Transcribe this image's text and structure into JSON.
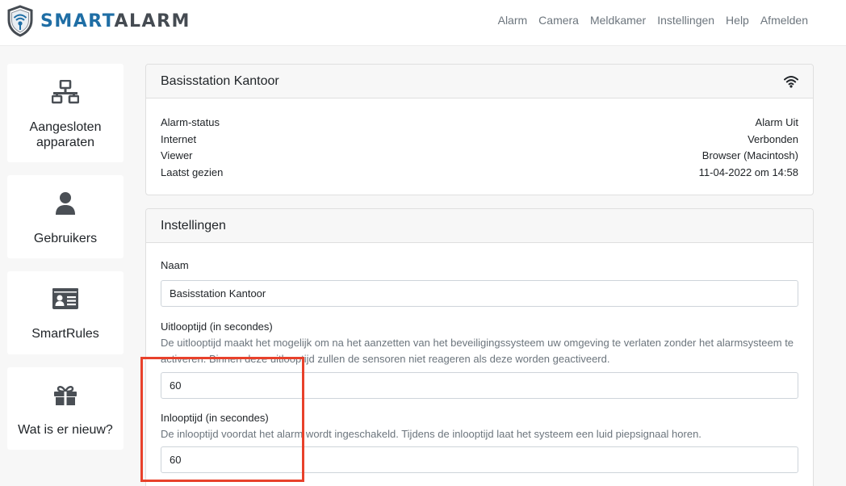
{
  "brand": {
    "part1": "SMART",
    "part2": "ALARM"
  },
  "nav": [
    "Alarm",
    "Camera",
    "Meldkamer",
    "Instellingen",
    "Help",
    "Afmelden"
  ],
  "sidebar": {
    "tiles": [
      {
        "label_line1": "Aangesloten",
        "label_line2": "apparaten",
        "icon": "network-icon"
      },
      {
        "label": "Gebruikers",
        "icon": "user-icon"
      },
      {
        "label": "SmartRules",
        "icon": "id-card-icon"
      },
      {
        "label": "Wat is er nieuw?",
        "icon": "gift-icon"
      }
    ]
  },
  "station": {
    "title": "Basisstation Kantoor",
    "rows": [
      {
        "label": "Alarm-status",
        "value": "Alarm Uit"
      },
      {
        "label": "Internet",
        "value": "Verbonden"
      },
      {
        "label": "Viewer",
        "value": "Browser (Macintosh)"
      },
      {
        "label": "Laatst gezien",
        "value": "11-04-2022 om 14:58"
      }
    ]
  },
  "settings": {
    "title": "Instellingen",
    "name_label": "Naam",
    "name_value": "Basisstation Kantoor",
    "exit_label": "Uitlooptijd (in secondes)",
    "exit_help": "De uitlooptijd maakt het mogelijk om na het aanzetten van het beveiligingssysteem uw omgeving te verlaten zonder het alarmsysteem te activeren. Binnen deze uitlooptijd zullen de sensoren niet reageren als deze worden geactiveerd.",
    "exit_value": "60",
    "entry_label": "Inlooptijd (in secondes)",
    "entry_help": "De inlooptijd voordat het alarm wordt ingeschakeld. Tijdens de inlooptijd laat het systeem een luid piepsignaal horen.",
    "entry_value": "60"
  },
  "colors": {
    "brand_blue": "#1f6ea5",
    "brand_gray": "#454b52",
    "highlight": "#e8412b"
  }
}
